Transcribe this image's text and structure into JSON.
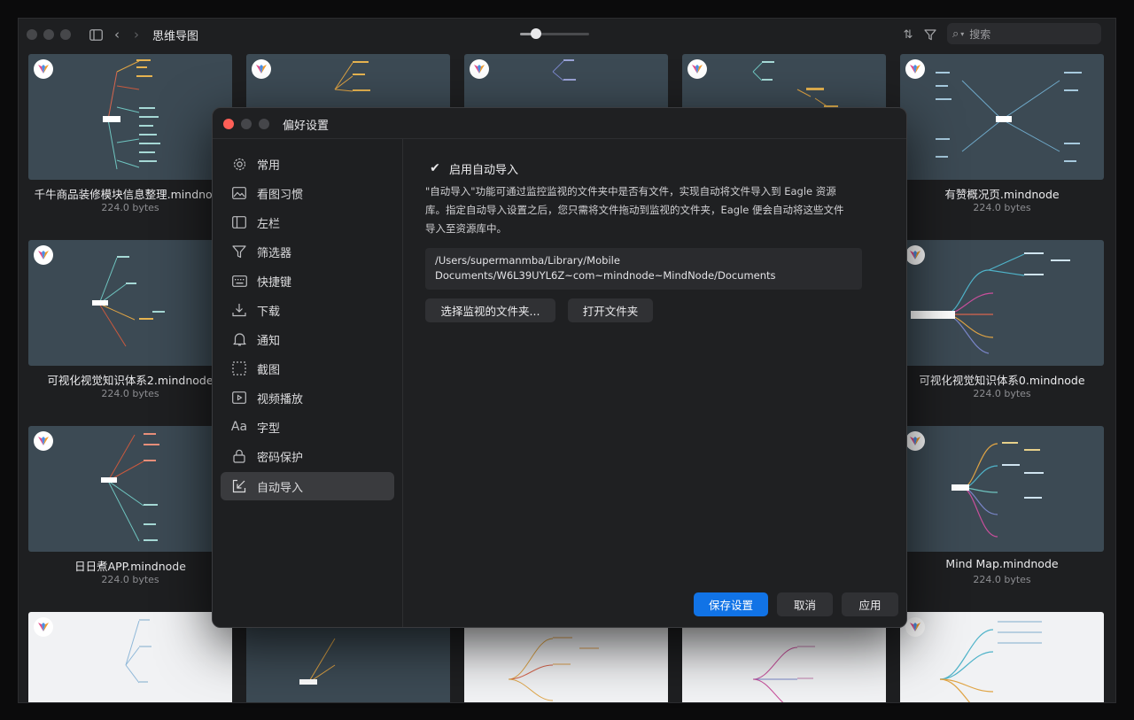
{
  "toolbar": {
    "title": "思维导图",
    "search_placeholder": "搜索"
  },
  "cards": [
    {
      "name": "千牛商品装修模块信息整理.mindnode",
      "size": "224.0 bytes"
    },
    {
      "name": "有赞概况页.mindnode",
      "size": "224.0 bytes"
    },
    {
      "name": "可视化视觉知识体系2.mindnode",
      "size": "224.0 bytes"
    },
    {
      "name": "可视化视觉知识体系0.mindnode",
      "size": "224.0 bytes"
    },
    {
      "name": "日日煮APP.mindnode",
      "size": "224.0 bytes"
    },
    {
      "name": "Mind Map.mindnode",
      "size": "224.0 bytes"
    }
  ],
  "dialog": {
    "title": "偏好设置",
    "nav": [
      {
        "label": "常用",
        "icon": "gear-icon"
      },
      {
        "label": "看图习惯",
        "icon": "image-icon"
      },
      {
        "label": "左栏",
        "icon": "sidebar-icon"
      },
      {
        "label": "筛选器",
        "icon": "filter-icon"
      },
      {
        "label": "快捷键",
        "icon": "keyboard-icon"
      },
      {
        "label": "下载",
        "icon": "download-icon"
      },
      {
        "label": "通知",
        "icon": "bell-icon"
      },
      {
        "label": "截图",
        "icon": "screenshot-icon"
      },
      {
        "label": "视频播放",
        "icon": "video-icon"
      },
      {
        "label": "字型",
        "icon": "font-icon"
      },
      {
        "label": "密码保护",
        "icon": "lock-icon"
      },
      {
        "label": "自动导入",
        "icon": "import-icon"
      }
    ],
    "active_nav": "自动导入",
    "auto_import": {
      "enabled": true,
      "checkbox_label": "启用自动导入",
      "description": "\"自动导入\"功能可通过监控监视的文件夹中是否有文件，实现自动将文件导入到 Eagle 资源库。指定自动导入设置之后，您只需将文件拖动到监视的文件夹，Eagle 便会自动将这些文件导入至资源库中。",
      "path_line1": "/Users/supermanmba/Library/Mobile",
      "path_line2": "Documents/W6L39UYL6Z~com~mindnode~MindNode/Documents",
      "choose_folder_button": "选择监视的文件夹...",
      "open_folder_button": "打开文件夹"
    },
    "footer": {
      "save": "保存设置",
      "cancel": "取消",
      "apply": "应用"
    }
  },
  "colors": {
    "accent": "#1173e6",
    "close": "#ff5f57",
    "thumb_dark": "#3c4a54"
  }
}
